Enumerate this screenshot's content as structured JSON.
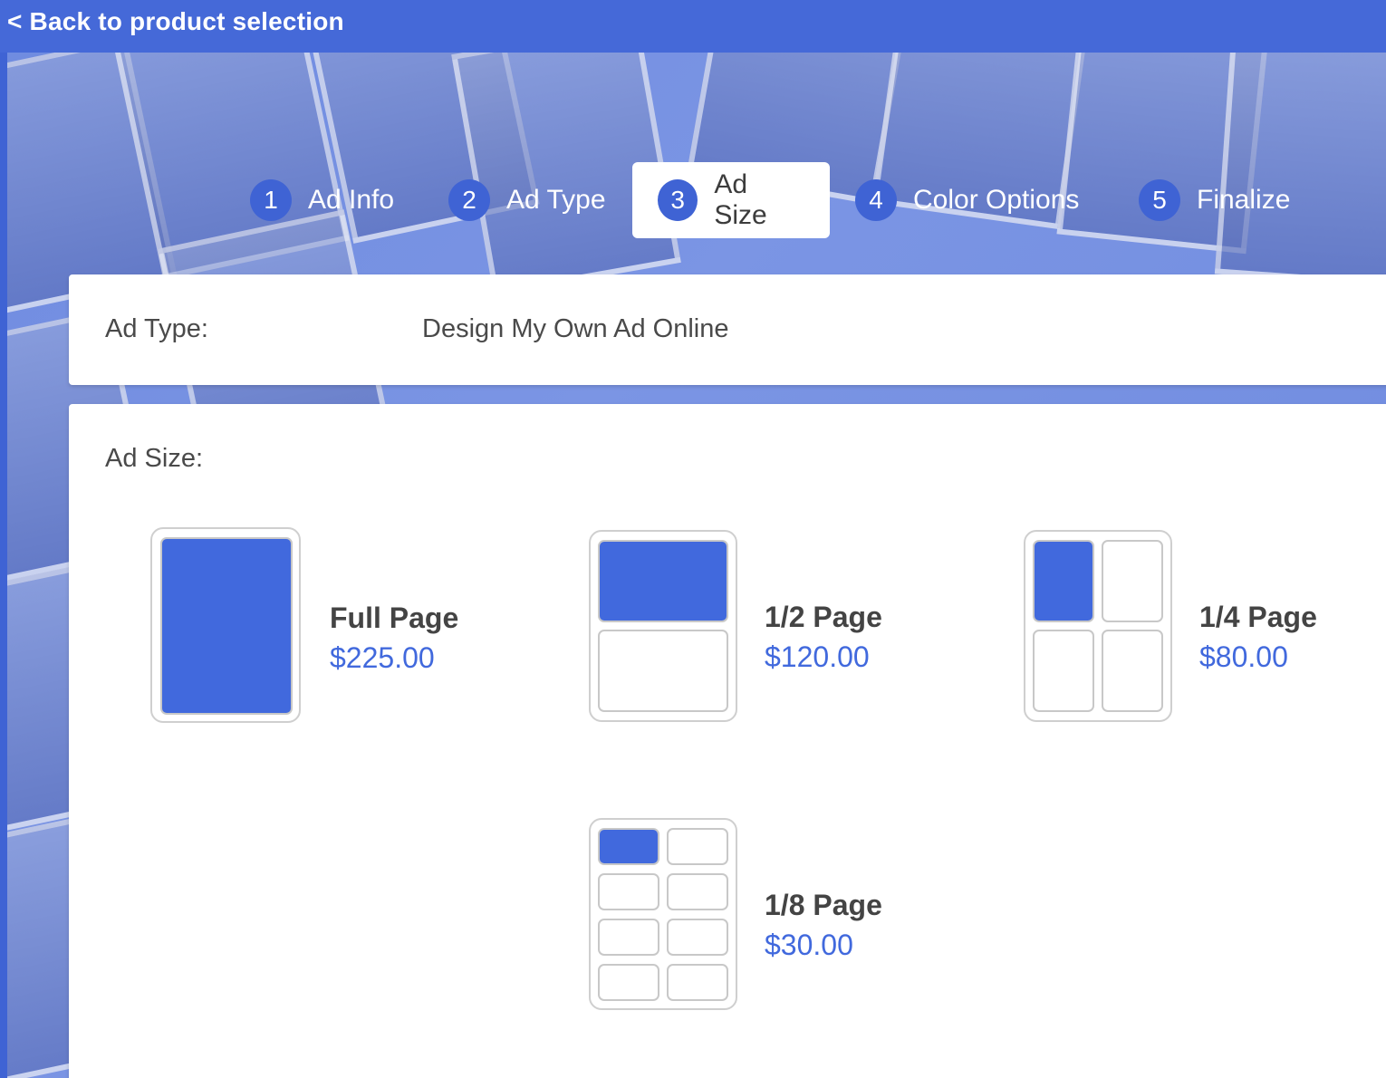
{
  "nav": {
    "back_label": "< Back to product selection"
  },
  "steps": [
    {
      "number": "1",
      "label": "Ad Info",
      "active": false
    },
    {
      "number": "2",
      "label": "Ad Type",
      "active": false
    },
    {
      "number": "3",
      "label": "Ad Size",
      "active": true
    },
    {
      "number": "4",
      "label": "Color Options",
      "active": false
    },
    {
      "number": "5",
      "label": "Finalize",
      "active": false
    }
  ],
  "ad_type": {
    "label": "Ad Type:",
    "value": "Design My Own Ad Online"
  },
  "ad_size": {
    "label": "Ad Size:",
    "options": [
      {
        "name": "Full Page",
        "price": "$225.00"
      },
      {
        "name": "1/2 Page",
        "price": "$120.00"
      },
      {
        "name": "1/4 Page",
        "price": "$80.00"
      },
      {
        "name": "1/8 Page",
        "price": "$30.00"
      }
    ]
  },
  "colors": {
    "accent": "#4169dd",
    "step_circle": "#3f63d4",
    "topbar": "#4569d8"
  }
}
